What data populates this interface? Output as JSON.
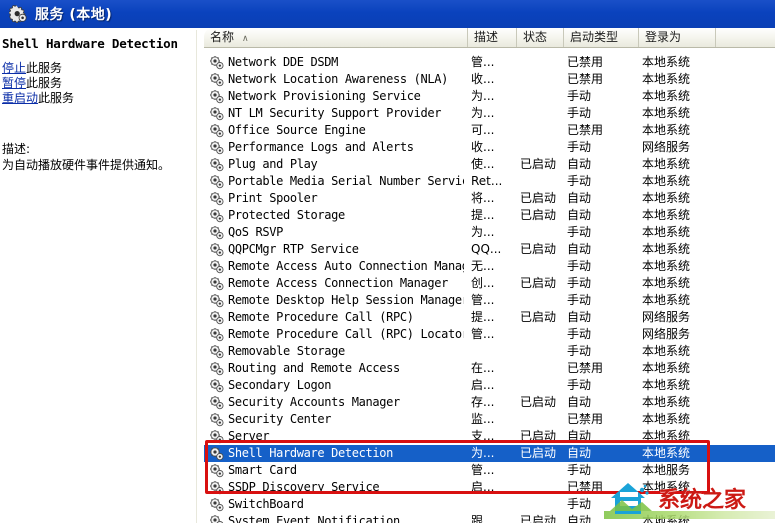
{
  "window": {
    "title": "服务 (本地)",
    "icon": "gear-icon"
  },
  "colors": {
    "titlebar": "#0a42bd",
    "selection": "#1560c8",
    "annotation": "#d81010",
    "link": "#0b2ea8",
    "watermark": "#cc1a14"
  },
  "detail_pane": {
    "service_name": "Shell Hardware Detection",
    "actions": [
      {
        "link": "停止",
        "suffix": "此服务"
      },
      {
        "link": "暂停",
        "suffix": "此服务"
      },
      {
        "link": "重启动",
        "suffix": "此服务"
      }
    ],
    "description_label": "描述:",
    "description_text": "为自动播放硬件事件提供通知。"
  },
  "list": {
    "columns": [
      {
        "label": "名称",
        "sort": "∧"
      },
      {
        "label": "描述",
        "sort": ""
      },
      {
        "label": "状态",
        "sort": ""
      },
      {
        "label": "启动类型",
        "sort": ""
      },
      {
        "label": "登录为",
        "sort": ""
      },
      {
        "label": "",
        "sort": ""
      }
    ],
    "rows": [
      {
        "name": "Network DDE DSDM",
        "desc": "管...",
        "status": "",
        "startup": "已禁用",
        "logon": "本地系统",
        "selected": false
      },
      {
        "name": "Network Location Awareness (NLA)",
        "desc": "收...",
        "status": "",
        "startup": "已禁用",
        "logon": "本地系统",
        "selected": false
      },
      {
        "name": "Network Provisioning Service",
        "desc": "为...",
        "status": "",
        "startup": "手动",
        "logon": "本地系统",
        "selected": false
      },
      {
        "name": "NT LM Security Support Provider",
        "desc": "为...",
        "status": "",
        "startup": "手动",
        "logon": "本地系统",
        "selected": false
      },
      {
        "name": "Office Source Engine",
        "desc": "可...",
        "status": "",
        "startup": "已禁用",
        "logon": "本地系统",
        "selected": false
      },
      {
        "name": "Performance Logs and Alerts",
        "desc": "收...",
        "status": "",
        "startup": "手动",
        "logon": "网络服务",
        "selected": false
      },
      {
        "name": "Plug and Play",
        "desc": "使...",
        "status": "已启动",
        "startup": "自动",
        "logon": "本地系统",
        "selected": false
      },
      {
        "name": "Portable Media Serial Number Service",
        "desc": "Ret...",
        "status": "",
        "startup": "手动",
        "logon": "本地系统",
        "selected": false
      },
      {
        "name": "Print Spooler",
        "desc": "将...",
        "status": "已启动",
        "startup": "自动",
        "logon": "本地系统",
        "selected": false
      },
      {
        "name": "Protected Storage",
        "desc": "提...",
        "status": "已启动",
        "startup": "自动",
        "logon": "本地系统",
        "selected": false
      },
      {
        "name": "QoS RSVP",
        "desc": "为...",
        "status": "",
        "startup": "手动",
        "logon": "本地系统",
        "selected": false
      },
      {
        "name": "QQPCMgr RTP Service",
        "desc": "QQ...",
        "status": "已启动",
        "startup": "自动",
        "logon": "本地系统",
        "selected": false
      },
      {
        "name": "Remote Access Auto Connection Manager",
        "desc": "无...",
        "status": "",
        "startup": "手动",
        "logon": "本地系统",
        "selected": false
      },
      {
        "name": "Remote Access Connection Manager",
        "desc": "创...",
        "status": "已启动",
        "startup": "手动",
        "logon": "本地系统",
        "selected": false
      },
      {
        "name": "Remote Desktop Help Session Manager",
        "desc": "管...",
        "status": "",
        "startup": "手动",
        "logon": "本地系统",
        "selected": false
      },
      {
        "name": "Remote Procedure Call (RPC)",
        "desc": "提...",
        "status": "已启动",
        "startup": "自动",
        "logon": "网络服务",
        "selected": false
      },
      {
        "name": "Remote Procedure Call (RPC) Locator",
        "desc": "管...",
        "status": "",
        "startup": "手动",
        "logon": "网络服务",
        "selected": false
      },
      {
        "name": "Removable Storage",
        "desc": "",
        "status": "",
        "startup": "手动",
        "logon": "本地系统",
        "selected": false
      },
      {
        "name": "Routing and Remote Access",
        "desc": "在...",
        "status": "",
        "startup": "已禁用",
        "logon": "本地系统",
        "selected": false
      },
      {
        "name": "Secondary Logon",
        "desc": "启...",
        "status": "",
        "startup": "手动",
        "logon": "本地系统",
        "selected": false
      },
      {
        "name": "Security Accounts Manager",
        "desc": "存...",
        "status": "已启动",
        "startup": "自动",
        "logon": "本地系统",
        "selected": false
      },
      {
        "name": "Security Center",
        "desc": "监...",
        "status": "",
        "startup": "已禁用",
        "logon": "本地系统",
        "selected": false
      },
      {
        "name": "Server",
        "desc": "支...",
        "status": "已启动",
        "startup": "自动",
        "logon": "本地系统",
        "selected": false
      },
      {
        "name": "Shell Hardware Detection",
        "desc": "为...",
        "status": "已启动",
        "startup": "自动",
        "logon": "本地系统",
        "selected": true
      },
      {
        "name": "Smart Card",
        "desc": "管...",
        "status": "",
        "startup": "手动",
        "logon": "本地服务",
        "selected": false
      },
      {
        "name": "SSDP Discovery Service",
        "desc": "启...",
        "status": "",
        "startup": "已禁用",
        "logon": "本地系统",
        "selected": false
      },
      {
        "name": "SwitchBoard",
        "desc": "",
        "status": "",
        "startup": "手动",
        "logon": "",
        "selected": false
      },
      {
        "name": "System Event Notification",
        "desc": "跟...",
        "status": "已启动",
        "startup": "自动",
        "logon": "本地系统",
        "selected": false
      }
    ]
  },
  "watermark": {
    "text": "系统之家"
  }
}
